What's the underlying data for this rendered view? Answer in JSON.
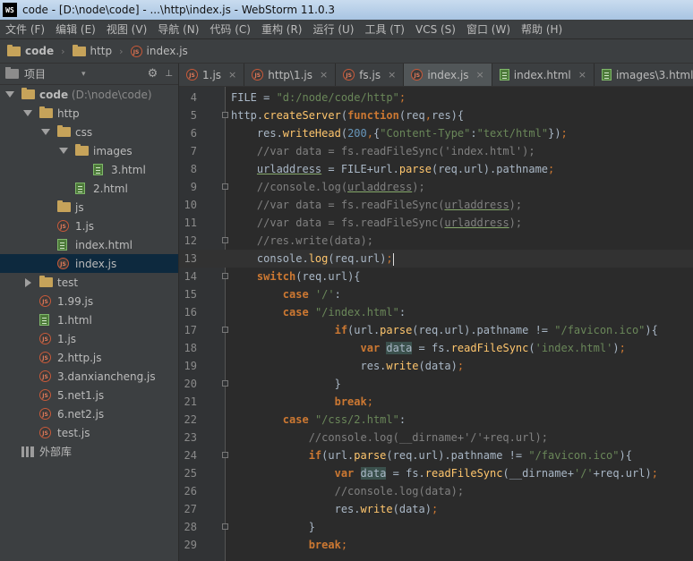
{
  "window": {
    "title": "code - [D:\\node\\code] - ...\\http\\index.js - WebStorm 11.0.3",
    "app_badge": "WS"
  },
  "menu": [
    {
      "label": "文件 (F)",
      "name": "menu-file"
    },
    {
      "label": "编辑 (E)",
      "name": "menu-edit"
    },
    {
      "label": "视图 (V)",
      "name": "menu-view"
    },
    {
      "label": "导航 (N)",
      "name": "menu-navigate"
    },
    {
      "label": "代码 (C)",
      "name": "menu-code"
    },
    {
      "label": "重构 (R)",
      "name": "menu-refactor"
    },
    {
      "label": "运行 (U)",
      "name": "menu-run"
    },
    {
      "label": "工具 (T)",
      "name": "menu-tools"
    },
    {
      "label": "VCS (S)",
      "name": "menu-vcs"
    },
    {
      "label": "窗口 (W)",
      "name": "menu-window"
    },
    {
      "label": "帮助 (H)",
      "name": "menu-help"
    }
  ],
  "breadcrumb": {
    "root": "code",
    "folder": "http",
    "file": "index.js"
  },
  "project_panel": {
    "title": "项目",
    "dropdown": "▾",
    "settings": "⚙",
    "hide": "⊥"
  },
  "tree": [
    {
      "label": "code",
      "path": " (D:\\node\\code)",
      "icon": "folder-icon",
      "arrow": "down",
      "level": 0
    },
    {
      "label": "http",
      "icon": "folder-icon",
      "arrow": "down",
      "level": 1
    },
    {
      "label": "css",
      "icon": "folder-icon",
      "arrow": "down",
      "level": 2
    },
    {
      "label": "images",
      "icon": "folder-icon",
      "arrow": "down",
      "level": 3
    },
    {
      "label": "3.html",
      "icon": "html-icon",
      "level": 4
    },
    {
      "label": "2.html",
      "icon": "html-icon",
      "level": 3
    },
    {
      "label": "js",
      "icon": "folder-icon",
      "level": 2
    },
    {
      "label": "1.js",
      "icon": "js-icon",
      "level": 2
    },
    {
      "label": "index.html",
      "icon": "html-icon",
      "level": 2
    },
    {
      "label": "index.js",
      "icon": "js-icon",
      "level": 2,
      "selected": true
    },
    {
      "label": "test",
      "icon": "folder-icon",
      "arrow": "right",
      "level": 1
    },
    {
      "label": "1.99.js",
      "icon": "js-icon",
      "level": 1
    },
    {
      "label": "1.html",
      "icon": "html-icon",
      "level": 1
    },
    {
      "label": "1.js",
      "icon": "js-icon",
      "level": 1
    },
    {
      "label": "2.http.js",
      "icon": "js-icon",
      "level": 1
    },
    {
      "label": "3.danxiancheng.js",
      "icon": "js-icon",
      "level": 1
    },
    {
      "label": "5.net1.js",
      "icon": "js-icon",
      "level": 1
    },
    {
      "label": "6.net2.js",
      "icon": "js-icon",
      "level": 1
    },
    {
      "label": "test.js",
      "icon": "js-icon",
      "level": 1
    },
    {
      "label": "外部库",
      "icon": "library-icon",
      "level": 0
    }
  ],
  "tabs": [
    {
      "label": "1.js",
      "icon": "js-icon",
      "close": "×"
    },
    {
      "label": "http\\1.js",
      "icon": "js-icon",
      "close": "×"
    },
    {
      "label": "fs.js",
      "icon": "js-icon",
      "close": "×"
    },
    {
      "label": "index.js",
      "icon": "js-icon",
      "close": "×",
      "active": true
    },
    {
      "label": "index.html",
      "icon": "html-icon",
      "close": "×"
    },
    {
      "label": "images\\3.html",
      "icon": "html-icon",
      "close": "×"
    }
  ],
  "editor": {
    "current_line": 13,
    "lines": [
      {
        "n": "4",
        "fold": false,
        "tokens": [
          [
            "",
            "FILE = "
          ],
          [
            "str",
            "\"d:/node/code/http\""
          ],
          [
            "pn",
            ";"
          ]
        ]
      },
      {
        "n": "5",
        "fold": true,
        "tokens": [
          [
            "",
            "http."
          ],
          [
            "fn",
            "createServer"
          ],
          [
            "",
            "("
          ],
          [
            "kw",
            "function"
          ],
          [
            "",
            "(req"
          ],
          [
            "pn",
            ","
          ],
          [
            "",
            "res){"
          ]
        ]
      },
      {
        "n": "6",
        "fold": false,
        "tokens": [
          [
            "",
            "    res."
          ],
          [
            "fn",
            "writeHead"
          ],
          [
            "",
            "("
          ],
          [
            "num",
            "200"
          ],
          [
            "pn",
            ","
          ],
          [
            "",
            "{"
          ],
          [
            "str",
            "\"Content-Type\""
          ],
          [
            "",
            ":"
          ],
          [
            "str",
            "\"text/html\""
          ],
          [
            "",
            "})"
          ],
          [
            "pn",
            ";"
          ]
        ]
      },
      {
        "n": "7",
        "fold": false,
        "tokens": [
          [
            "cm",
            "    //var data = fs.readFileSync('index.html');"
          ]
        ]
      },
      {
        "n": "8",
        "fold": false,
        "tokens": [
          [
            "",
            "    "
          ],
          [
            "ul",
            "urladdress"
          ],
          [
            "",
            " = FILE+url."
          ],
          [
            "fn",
            "parse"
          ],
          [
            "",
            "(req.url).pathname"
          ],
          [
            "pn",
            ";"
          ]
        ]
      },
      {
        "n": "9",
        "fold": true,
        "tokens": [
          [
            "cm",
            "    //console.log("
          ],
          [
            "cm ul",
            "urladdress"
          ],
          [
            "cm",
            ");"
          ]
        ]
      },
      {
        "n": "10",
        "fold": false,
        "tokens": [
          [
            "cm",
            "    //var data = fs.readFileSync("
          ],
          [
            "cm ul",
            "urladdress"
          ],
          [
            "cm",
            ");"
          ]
        ]
      },
      {
        "n": "11",
        "fold": false,
        "tokens": [
          [
            "cm",
            "    //var data = fs.readFileSync("
          ],
          [
            "cm ul",
            "urladdress"
          ],
          [
            "cm",
            ");"
          ]
        ]
      },
      {
        "n": "12",
        "fold": true,
        "tokens": [
          [
            "cm",
            "    //res.write(data);"
          ]
        ]
      },
      {
        "n": "13",
        "fold": false,
        "tokens": [
          [
            "",
            "    console."
          ],
          [
            "fn",
            "log"
          ],
          [
            "",
            "(req.url)"
          ],
          [
            "pn",
            ";"
          ],
          [
            "caret",
            ""
          ]
        ]
      },
      {
        "n": "14",
        "fold": true,
        "tokens": [
          [
            "",
            "    "
          ],
          [
            "kw",
            "switch"
          ],
          [
            "",
            "(req.url){"
          ]
        ]
      },
      {
        "n": "15",
        "fold": false,
        "tokens": [
          [
            "",
            "        "
          ],
          [
            "kw",
            "case"
          ],
          [
            "",
            " "
          ],
          [
            "str",
            "'/'"
          ],
          [
            "",
            ":"
          ]
        ]
      },
      {
        "n": "16",
        "fold": false,
        "tokens": [
          [
            "",
            "        "
          ],
          [
            "kw",
            "case"
          ],
          [
            "",
            " "
          ],
          [
            "str",
            "\"/index.html\""
          ],
          [
            "",
            ":"
          ]
        ]
      },
      {
        "n": "17",
        "fold": true,
        "tokens": [
          [
            "",
            "                "
          ],
          [
            "kw",
            "if"
          ],
          [
            "",
            "(url."
          ],
          [
            "fn",
            "parse"
          ],
          [
            "",
            "(req.url).pathname != "
          ],
          [
            "str",
            "\"/favicon.ico\""
          ],
          [
            "",
            "){"
          ]
        ]
      },
      {
        "n": "18",
        "fold": false,
        "tokens": [
          [
            "",
            "                    "
          ],
          [
            "kw",
            "var"
          ],
          [
            "",
            " "
          ],
          [
            "hl",
            "data"
          ],
          [
            "",
            " = fs."
          ],
          [
            "fn",
            "readFileSync"
          ],
          [
            "",
            "("
          ],
          [
            "str",
            "'index.html'"
          ],
          [
            "",
            ")"
          ],
          [
            "pn",
            ";"
          ]
        ]
      },
      {
        "n": "19",
        "fold": false,
        "tokens": [
          [
            "",
            "                    res."
          ],
          [
            "fn",
            "write"
          ],
          [
            "",
            "(data)"
          ],
          [
            "pn",
            ";"
          ]
        ]
      },
      {
        "n": "20",
        "fold": true,
        "tokens": [
          [
            "",
            "                }"
          ]
        ]
      },
      {
        "n": "21",
        "fold": false,
        "tokens": [
          [
            "",
            "                "
          ],
          [
            "kw",
            "break"
          ],
          [
            "pn",
            ";"
          ]
        ]
      },
      {
        "n": "22",
        "fold": false,
        "tokens": [
          [
            "",
            "        "
          ],
          [
            "kw",
            "case"
          ],
          [
            "",
            " "
          ],
          [
            "str",
            "\"/css/2.html\""
          ],
          [
            "",
            ":"
          ]
        ]
      },
      {
        "n": "23",
        "fold": false,
        "tokens": [
          [
            "cm",
            "            //console.log(__dirname+'/'+req.url);"
          ]
        ]
      },
      {
        "n": "24",
        "fold": true,
        "tokens": [
          [
            "",
            "            "
          ],
          [
            "kw",
            "if"
          ],
          [
            "",
            "(url."
          ],
          [
            "fn",
            "parse"
          ],
          [
            "",
            "(req.url).pathname != "
          ],
          [
            "str",
            "\"/favicon.ico\""
          ],
          [
            "",
            "){"
          ]
        ]
      },
      {
        "n": "25",
        "fold": false,
        "tokens": [
          [
            "",
            "                "
          ],
          [
            "kw",
            "var"
          ],
          [
            "",
            " "
          ],
          [
            "hl",
            "data"
          ],
          [
            "",
            " = fs."
          ],
          [
            "fn",
            "readFileSync"
          ],
          [
            "",
            "(__dirname+"
          ],
          [
            "str",
            "'/'"
          ],
          [
            "",
            "+req.url)"
          ],
          [
            "pn",
            ";"
          ]
        ]
      },
      {
        "n": "26",
        "fold": false,
        "tokens": [
          [
            "cm",
            "                //console.log(data);"
          ]
        ]
      },
      {
        "n": "27",
        "fold": false,
        "tokens": [
          [
            "",
            "                res."
          ],
          [
            "fn",
            "write"
          ],
          [
            "",
            "(data)"
          ],
          [
            "pn",
            ";"
          ]
        ]
      },
      {
        "n": "28",
        "fold": true,
        "tokens": [
          [
            "",
            "            }"
          ]
        ]
      },
      {
        "n": "29",
        "fold": false,
        "tokens": [
          [
            "",
            "            "
          ],
          [
            "kw",
            "break"
          ],
          [
            "pn",
            ";"
          ]
        ]
      }
    ]
  },
  "colors": {
    "keyword": "#cc7832",
    "string": "#6a8759",
    "comment": "#808080",
    "function": "#ffc66d",
    "number": "#6897bb",
    "selection": "#0d293e"
  }
}
